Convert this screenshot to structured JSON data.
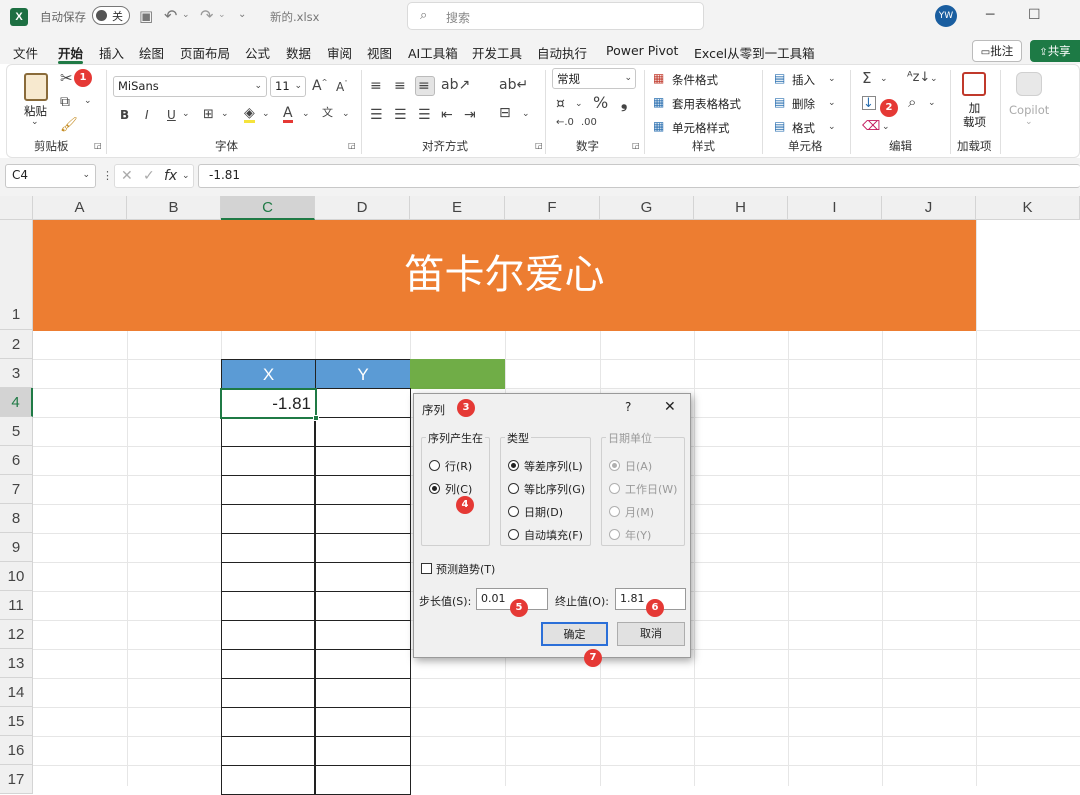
{
  "titlebar": {
    "autosave_label": "自动保存",
    "autosave_state": "关",
    "filename": "新的.xlsx",
    "search_placeholder": "搜索",
    "user_initials": "YW"
  },
  "menus": [
    "文件",
    "开始",
    "插入",
    "绘图",
    "页面布局",
    "公式",
    "数据",
    "审阅",
    "视图",
    "AI工具箱",
    "开发工具",
    "自动执行",
    "Power Pivot",
    "Excel从零到一工具箱"
  ],
  "menu_buttons": {
    "comment": "批注",
    "share": "共享"
  },
  "ribbon": {
    "clipboard": {
      "paste": "粘贴",
      "label": "剪贴板"
    },
    "font": {
      "name": "MiSans",
      "size": "11",
      "label": "字体",
      "bold": "B",
      "italic": "I",
      "underline": "U"
    },
    "alignment": {
      "label": "对齐方式"
    },
    "number": {
      "format": "常规",
      "label": "数字",
      "percent": "%"
    },
    "styles": {
      "conditional": "条件格式",
      "table": "套用表格格式",
      "cell": "单元格样式",
      "label": "样式"
    },
    "cells": {
      "insert": "插入",
      "delete": "删除",
      "format": "格式",
      "label": "单元格"
    },
    "editing": {
      "label": "编辑"
    },
    "addins": {
      "name": "加\n载项",
      "label": "加载项"
    },
    "copilot": {
      "name": "Copilot"
    }
  },
  "formula_bar": {
    "name_box": "C4",
    "fx": "fx",
    "value": "-1.81"
  },
  "columns": [
    "A",
    "B",
    "C",
    "D",
    "E",
    "F",
    "G",
    "H",
    "I",
    "J",
    "K"
  ],
  "rows": [
    "1",
    "2",
    "3",
    "4",
    "5",
    "6",
    "7",
    "8",
    "9",
    "10",
    "11",
    "12",
    "13",
    "14",
    "15",
    "16",
    "17"
  ],
  "sheet": {
    "banner_title": "笛卡尔爱心",
    "header_x": "X",
    "header_y": "Y",
    "c4_value": "-1.81",
    "banner_color": "#ed7d31",
    "header_color": "#5b9bd5",
    "green_color": "#70ad47"
  },
  "dialog": {
    "title": "序列",
    "help": "?",
    "close": "✕",
    "series_in_label": "序列产生在",
    "row": "行(R)",
    "col": "列(C)",
    "type_label": "类型",
    "linear": "等差序列(L)",
    "growth": "等比序列(G)",
    "date": "日期(D)",
    "autofill": "自动填充(F)",
    "date_unit_label": "日期单位",
    "day": "日(A)",
    "weekday": "工作日(W)",
    "month": "月(M)",
    "year": "年(Y)",
    "trend": "预测趋势(T)",
    "step_label": "步长值(S):",
    "step_value": "0.01",
    "stop_label": "终止值(O):",
    "stop_value": "1.81",
    "ok": "确定",
    "cancel": "取消"
  },
  "badges": [
    "1",
    "2",
    "3",
    "4",
    "5",
    "6",
    "7"
  ]
}
